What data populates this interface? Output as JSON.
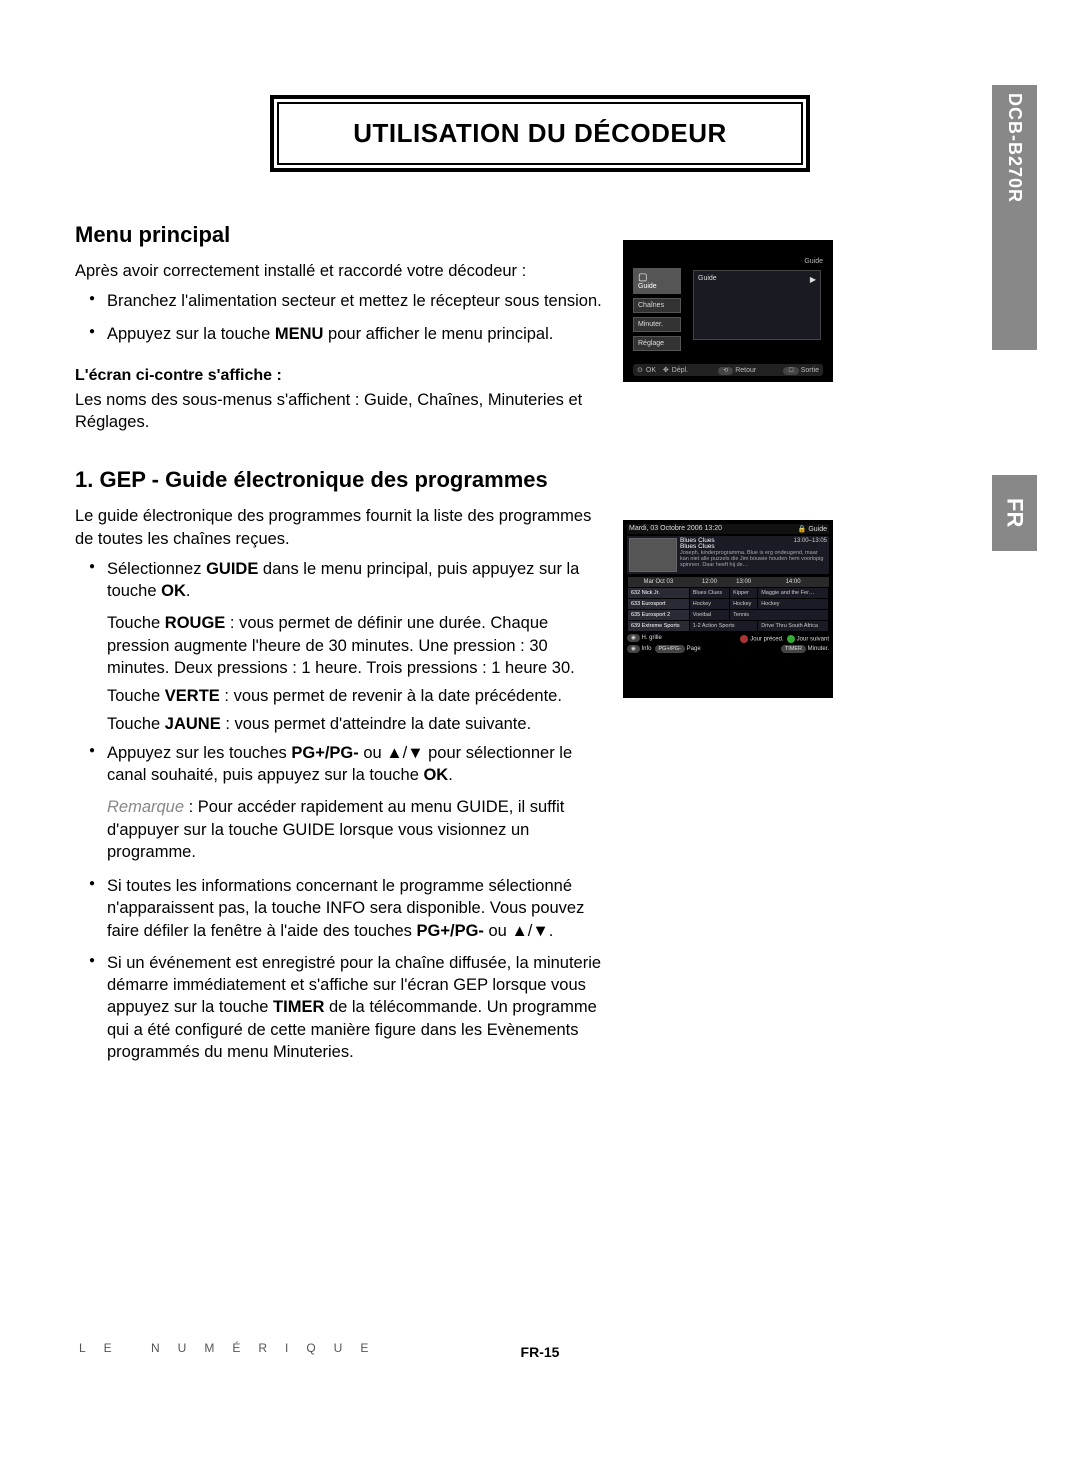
{
  "sideTab": {
    "model": "DCB-B270R",
    "lang": "FR"
  },
  "title": "UTILISATION DU DÉCODEUR",
  "section1": {
    "heading": "Menu principal",
    "intro": "Après avoir correctement installé et raccordé votre décodeur :",
    "b1": "Branchez l'alimentation secteur et mettez le récepteur sous tension.",
    "b2a": "Appuyez sur la touche ",
    "b2b_bold": "MENU",
    "b2c": " pour afficher le menu principal.",
    "sub": "L'écran ci-contre s'affiche :",
    "subtext": "Les noms des sous-menus s'affichent : Guide, Chaînes, Minuteries et Réglages."
  },
  "section2": {
    "heading": "1. GEP - Guide électronique des programmes",
    "intro": "Le guide électronique des programmes fournit la liste des programmes de toutes les chaînes reçues.",
    "b1a": "Sélectionnez ",
    "b1b_bold": "GUIDE",
    "b1c": " dans le menu principal, puis appuyez sur la touche ",
    "b1d_bold": "OK",
    "b1e": ".",
    "red_a": "Touche ",
    "red_b_bold": "ROUGE",
    "red_c": " : vous permet de définir une durée. Chaque pression augmente l'heure de 30 minutes. Une pression : 30 minutes. Deux pressions : 1 heure. Trois pressions : 1 heure 30.",
    "green_a": "Touche ",
    "green_b_bold": "VERTE",
    "green_c": " : vous permet de revenir à la date précédente.",
    "yellow_a": "Touche ",
    "yellow_b_bold": "JAUNE",
    "yellow_c": " : vous permet d'atteindre la date suivante.",
    "b2a": "Appuyez sur les touches ",
    "b2b_bold": "PG+/PG-",
    "b2c": " ou ▲/▼ pour sélectionner le canal souhaité, puis appuyez sur la touche ",
    "b2d_bold": "OK",
    "b2e": ".",
    "remark_label": "Remarque",
    "remark_text": " : Pour accéder rapidement au menu GUIDE, il suffit d'appuyer sur la touche GUIDE lorsque vous visionnez un programme.",
    "b3a": "Si toutes les informations concernant le programme sélectionné n'apparaissent pas, la touche INFO sera disponible. Vous pouvez faire défiler la fenêtre à l'aide des touches ",
    "b3b_bold": "PG+/PG-",
    "b3c": " ou ▲/▼.",
    "b4a": "Si un événement est enregistré pour la chaîne diffusée, la minuterie démarre immédiatement et s'affiche sur l'écran GEP lorsque vous appuyez sur la touche ",
    "b4b_bold": "TIMER",
    "b4c": " de la télécommande. Un programme qui a été configuré de cette manière figure dans les Evènements programmés du menu Minuteries."
  },
  "shot1": {
    "topbar_label": "Guide",
    "side_items": [
      "Guide",
      "Chaînes",
      "Minuter.",
      "Réglage"
    ],
    "panel_label": "Guide",
    "foot_ok": "OK",
    "foot_depl": "Dépl.",
    "foot_retour": "Retour",
    "foot_sortie": "Sortie"
  },
  "shot2": {
    "date": "Mardi, 03 Octobre 2006  13:20",
    "corner": "Guide",
    "prog_title": "Blues Clues",
    "prog_time": "13:00–13:05",
    "prog_desc": "Joseph, kinderprogramma. Blue is erg ondeugend, maar kan niet alle puzzels die Jim bouwie houden hem voorlopig spinnen. Daar heeft hij de…",
    "cols": [
      "Mar Oct 03",
      "12:00",
      "13:00",
      "14:00"
    ],
    "rows": [
      {
        "ch": "632 Nick Jr.",
        "c1": "Blues Clues",
        "c2": "Kipper",
        "c3": "Maggie and the Fer…"
      },
      {
        "ch": "633 Eurosport",
        "c1": "Hockey",
        "c2": "Hockey",
        "c3": "Hockey"
      },
      {
        "ch": "635 Eurosport 2",
        "c1": "Voetbal",
        "c2": "Tennis",
        "c3": ""
      },
      {
        "ch": "639 Extreme Sports",
        "c1": "1-2 Action Sports",
        "c2": "",
        "c3": "Drive Thru South Africa"
      }
    ],
    "foot_grille": "H. grille",
    "foot_info": "Info",
    "foot_page": "Page",
    "foot_prev": "Jour préced.",
    "foot_next": "Jour suivant",
    "foot_timer": "Minuter."
  },
  "footer": {
    "brand": "LE NUMÉRIQUE",
    "page": "FR-15"
  }
}
